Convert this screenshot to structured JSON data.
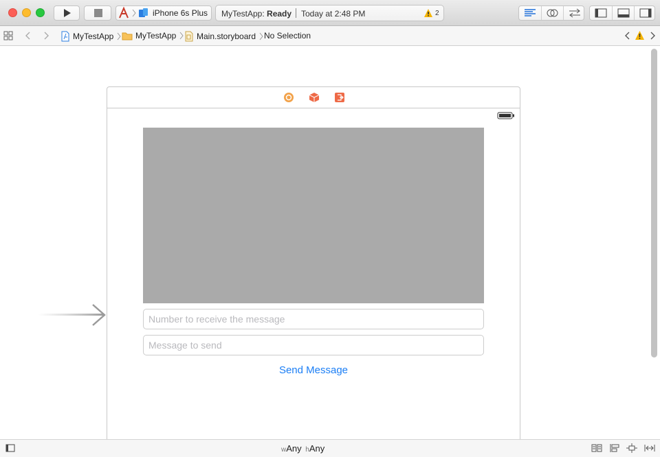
{
  "toolbar": {
    "scheme_device": "iPhone 6s Plus",
    "activity_app": "MyTestApp:",
    "activity_status": "Ready",
    "activity_time": "Today at 2:48 PM",
    "warning_count": "2"
  },
  "breadcrumbs": {
    "project": "MyTestApp",
    "group": "MyTestApp",
    "file": "Main.storyboard",
    "selection": "No Selection"
  },
  "scene": {
    "number_placeholder": "Number to receive the message",
    "message_placeholder": "Message to send",
    "send_label": "Send Message"
  },
  "size_class": {
    "w_prefix": "w",
    "w_value": "Any",
    "h_prefix": "h",
    "h_value": "Any"
  },
  "colors": {
    "accent": "#1b7ef5",
    "image_view": "#aaaaaa",
    "warning": "#f5b400",
    "dock_icon_orange": "#f2a24a",
    "dock_icon_red": "#ee6a47",
    "selected_tool": "#1e6fd9"
  }
}
